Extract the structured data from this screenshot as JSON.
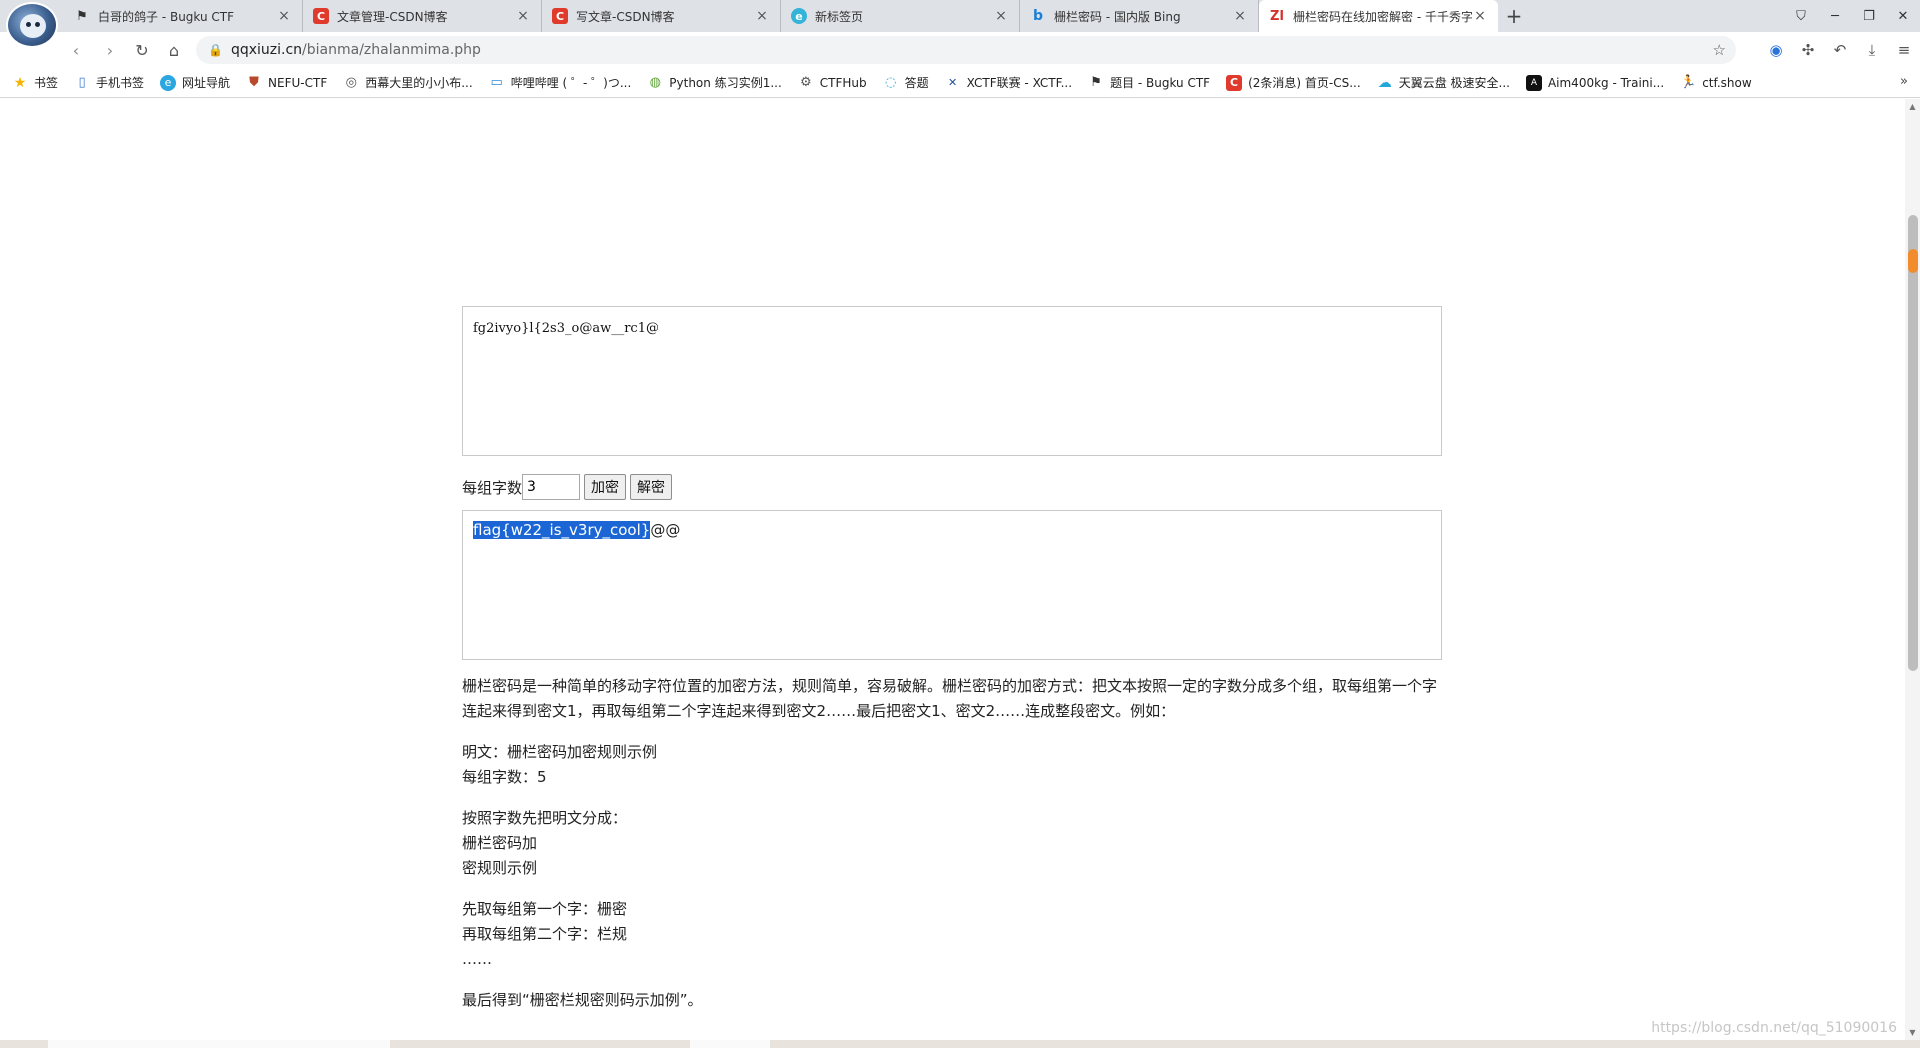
{
  "tabs": [
    {
      "title": "白哥的鸽子 - Bugku CTF",
      "icon": "flag-icon",
      "color": "#333333",
      "active": false
    },
    {
      "title": "文章管理-CSDN博客",
      "icon": "csdn-icon",
      "color": "#e03a2d",
      "active": false
    },
    {
      "title": "写文章-CSDN博客",
      "icon": "csdn-icon",
      "color": "#e03a2d",
      "active": false
    },
    {
      "title": "新标签页",
      "icon": "edge-icon",
      "color": "#34b4d9",
      "active": false
    },
    {
      "title": "栅栏密码 - 国内版 Bing",
      "icon": "bing-icon",
      "color": "#1b7fd6",
      "active": false
    },
    {
      "title": "栅栏密码在线加密解密 - 千千秀字",
      "icon": "qqxiuzi-icon",
      "color": "#d2332b",
      "active": true
    }
  ],
  "address": {
    "host": "qqxiuzi.cn",
    "path": "/bianma/zhalanmima.php"
  },
  "bookmarks": [
    {
      "label": "书签",
      "icon": "star-icon",
      "color": "#f5b400"
    },
    {
      "label": "手机书签",
      "icon": "phone-icon",
      "color": "#3a7bd5"
    },
    {
      "label": "网址导航",
      "icon": "browser-icon",
      "color": "#2aa7e0"
    },
    {
      "label": "NEFU-CTF",
      "icon": "shield-icon",
      "color": "#b84a2b"
    },
    {
      "label": "西幕大里的小小布...",
      "icon": "circle-icon",
      "color": "#555555"
    },
    {
      "label": "哔哩哔哩 ( ゜- ゜)つ...",
      "icon": "tv-icon",
      "color": "#2b8ad8"
    },
    {
      "label": "Python 练习实例1...",
      "icon": "runoob-icon",
      "color": "#5fa33a"
    },
    {
      "label": "CTFHub",
      "icon": "gear-icon",
      "color": "#555555"
    },
    {
      "label": "答题",
      "icon": "swirl-icon",
      "color": "#2aa7e0"
    },
    {
      "label": "XCTF联赛 - XCTF...",
      "icon": "x-icon",
      "color": "#1e4f9c"
    },
    {
      "label": "题目 - Bugku CTF",
      "icon": "flag-icon",
      "color": "#333333"
    },
    {
      "label": "(2条消息) 首页-CS...",
      "icon": "csdn-icon",
      "color": "#e03a2d"
    },
    {
      "label": "天翼云盘 极速安全...",
      "icon": "cloud-icon",
      "color": "#1fa8d8"
    },
    {
      "label": "Aim400kg - Traini...",
      "icon": "aim-icon",
      "color": "#111111"
    },
    {
      "label": "ctf.show",
      "icon": "runner-icon",
      "color": "#111111"
    }
  ],
  "page": {
    "input_text": "fg2ivyo}l{2s3_o@aw__rc1@",
    "group_label": "每组字数",
    "group_value": "3",
    "encrypt_label": "加密",
    "decrypt_label": "解密",
    "output_selected": "flag{w22_is_v3ry_cool}",
    "output_rest": "@@",
    "description": [
      "栅栏密码是一种简单的移动字符位置的加密方法，规则简单，容易破解。栅栏密码的加密方式：把文本按照一定的字数分成多个组，取每组第一个字连起来得到密文1，再取每组第二个字连起来得到密文2……最后把密文1、密文2……连成整段密文。例如：",
      "明文：栅栏密码加密规则示例",
      "每组字数：5",
      "按照字数先把明文分成：",
      "栅栏密码加",
      "密规则示例",
      "先取每组第一个字：栅密",
      "再取每组第二个字：栏规",
      "……",
      "最后得到“栅密栏规密则码示加例”。"
    ],
    "watermark": "https://blog.csdn.net/qq_51090016"
  }
}
